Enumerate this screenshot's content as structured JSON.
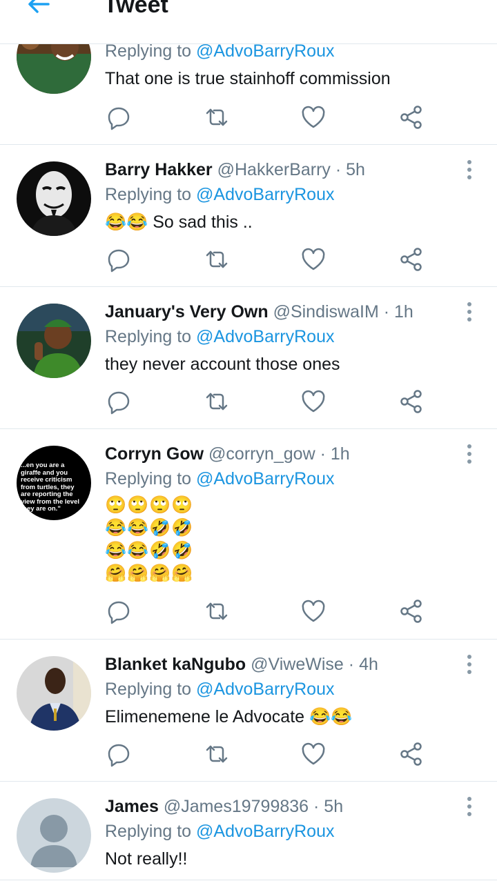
{
  "header": {
    "title": "Tweet",
    "back_icon": "arrow-left-icon"
  },
  "replies": [
    {
      "name": "",
      "handle": "",
      "time": "",
      "replying_label": "Replying to",
      "mention": "@AdvoBarryRoux",
      "text": "That one is true stainhoff commission"
    },
    {
      "name": "Barry Hakker",
      "handle": "@HakkerBarry",
      "time": "5h",
      "replying_label": "Replying to",
      "mention": "@AdvoBarryRoux",
      "text": "😂😂 So sad this .."
    },
    {
      "name": "January's Very Own",
      "handle": "@SindiswaIM",
      "time": "1h",
      "replying_label": "Replying to",
      "mention": "@AdvoBarryRoux",
      "text": "they never account those ones"
    },
    {
      "name": "Corryn Gow",
      "handle": "@corryn_gow",
      "time": "1h",
      "replying_label": "Replying to",
      "mention": "@AdvoBarryRoux",
      "text_lines": [
        "🙄🙄🙄🙄",
        "😂😂🤣🤣",
        "😂😂🤣🤣",
        "🤗🤗🤗🤗"
      ],
      "avatar_quote": [
        "...en you are a",
        "giraffe and you",
        "receive criticism",
        "from turtles, they",
        "are reporting the",
        "view from the level",
        "they are on.\""
      ]
    },
    {
      "name": "Blanket kaNgubo",
      "handle": "@ViweWise",
      "time": "4h",
      "replying_label": "Replying to",
      "mention": "@AdvoBarryRoux",
      "text": "Elimenemene le Advocate 😂😂"
    },
    {
      "name": "James",
      "handle": "@James19799836",
      "time": "5h",
      "replying_label": "Replying to",
      "mention": "@AdvoBarryRoux",
      "text": "Not really!!"
    }
  ],
  "separator": "·",
  "colors": {
    "link": "#1b95e0",
    "secondary": "#657786",
    "divider": "#e1e8ed",
    "primary_text": "#14171a"
  },
  "action_icons": [
    "reply-icon",
    "retweet-icon",
    "like-icon",
    "share-icon"
  ]
}
